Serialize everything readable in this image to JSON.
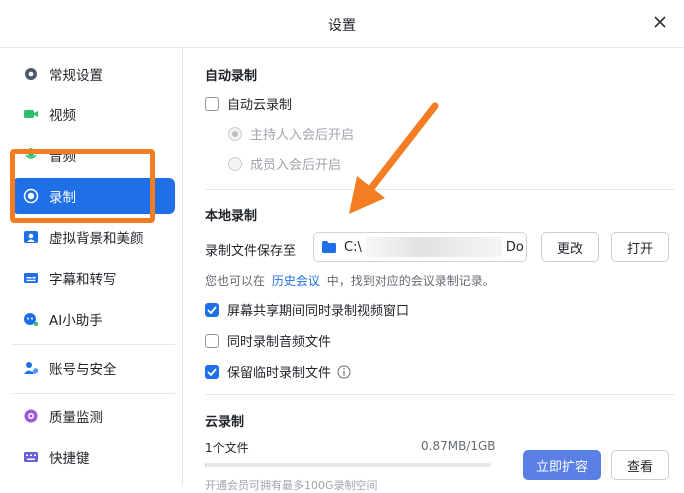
{
  "window": {
    "title": "设置"
  },
  "sidebar": {
    "items": [
      {
        "label": "常规设置",
        "icon": "gear-icon"
      },
      {
        "label": "视频",
        "icon": "video-camera-icon"
      },
      {
        "label": "音频",
        "icon": "audio-icon"
      },
      {
        "label": "录制",
        "icon": "record-icon"
      },
      {
        "label": "虚拟背景和美颜",
        "icon": "person-icon"
      },
      {
        "label": "字幕和转写",
        "icon": "subtitle-icon"
      },
      {
        "label": "AI小助手",
        "icon": "ai-assistant-icon"
      },
      {
        "label": "账号与安全",
        "icon": "account-security-icon"
      },
      {
        "label": "质量监测",
        "icon": "quality-monitor-icon"
      },
      {
        "label": "快捷键",
        "icon": "keyboard-icon"
      }
    ],
    "active_item": "录制"
  },
  "auto_record": {
    "title": "自动录制",
    "cloud_label": "自动云录制",
    "cloud_checked": false,
    "option_host": "主持人入会后开启",
    "option_member": "成员入会后开启",
    "selected_option": "主持人入会后开启"
  },
  "local_record": {
    "title": "本地录制",
    "save_to_label": "录制文件保存至",
    "path_start": "C:\\",
    "path_end": "Do",
    "change_button": "更改",
    "open_button": "打开",
    "hint_prefix": "您也可以在",
    "hint_link": "历史会议",
    "hint_suffix": "中，找到对应的会议录制记录。",
    "options": [
      {
        "label": "屏幕共享期间同时录制视频窗口",
        "checked": true
      },
      {
        "label": "同时录制音频文件",
        "checked": false
      },
      {
        "label": "保留临时录制文件",
        "checked": true
      }
    ]
  },
  "cloud_record": {
    "title": "云录制",
    "file_count": "1个文件",
    "usage": "0.87MB/1GB",
    "usage_fraction": 0.00085,
    "expand_button": "立即扩容",
    "view_button": "查看",
    "footer_note": "开通会员可拥有最多100G录制空间"
  },
  "colors": {
    "accent": "#1f6fe8",
    "annotation": "#f47c22"
  }
}
